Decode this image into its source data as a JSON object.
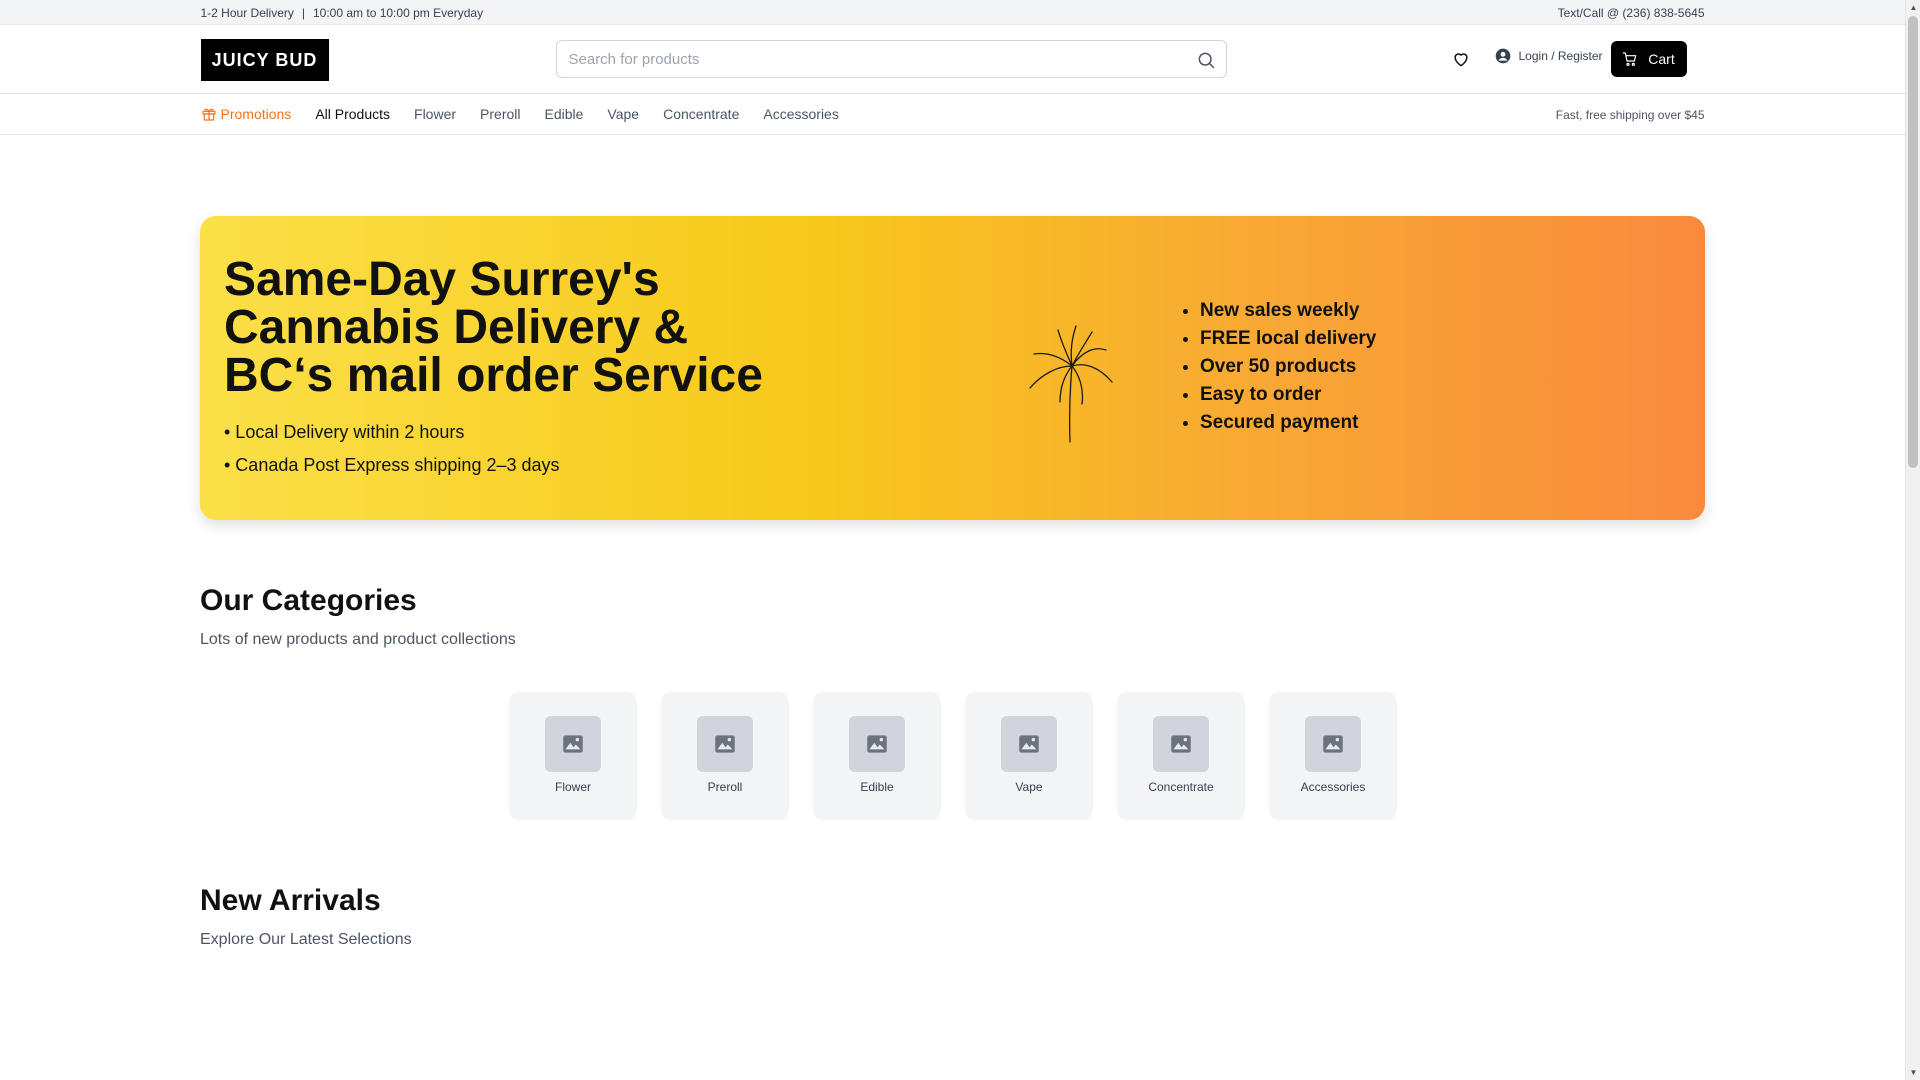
{
  "topbar": {
    "delivery": "1-2 Hour Delivery",
    "separator": "|",
    "hours": "10:00 am to 10:00 pm Everyday",
    "contact": "Text/Call @ (236) 838-5645"
  },
  "header": {
    "logo": "JUICY BUD",
    "search_placeholder": "Search for products",
    "login_label": "Login / Register",
    "cart_label": "Cart"
  },
  "nav": {
    "items": [
      {
        "label": "Promotions",
        "icon": "gift-icon"
      },
      {
        "label": "All Products"
      },
      {
        "label": "Flower"
      },
      {
        "label": "Preroll"
      },
      {
        "label": "Edible"
      },
      {
        "label": "Vape"
      },
      {
        "label": "Concentrate"
      },
      {
        "label": "Accessories"
      }
    ],
    "shipping_note": "Fast, free shipping over $45"
  },
  "hero": {
    "title": "Same-Day Surrey's Cannabis Delivery & BC‘s mail order Service",
    "lines": [
      "• Local Delivery within 2 hours",
      "• Canada Post Express shipping 2–3 days"
    ],
    "features": [
      "New sales weekly",
      "FREE local delivery",
      "Over 50 products",
      "Easy to order",
      "Secured payment"
    ],
    "icon": "palm-tree-icon"
  },
  "categories": {
    "title": "Our Categories",
    "subtitle": "Lots of new products and product collections",
    "items": [
      {
        "label": "Flower"
      },
      {
        "label": "Preroll"
      },
      {
        "label": "Edible"
      },
      {
        "label": "Vape"
      },
      {
        "label": "Concentrate"
      },
      {
        "label": "Accessories"
      }
    ]
  },
  "new_arrivals": {
    "title": "New Arrivals",
    "subtitle": "Explore Our Latest Selections"
  },
  "colors": {
    "accent_promo": "#f97316",
    "hero_gradient_start": "#fbe048",
    "hero_gradient_end": "#f98a3d"
  }
}
